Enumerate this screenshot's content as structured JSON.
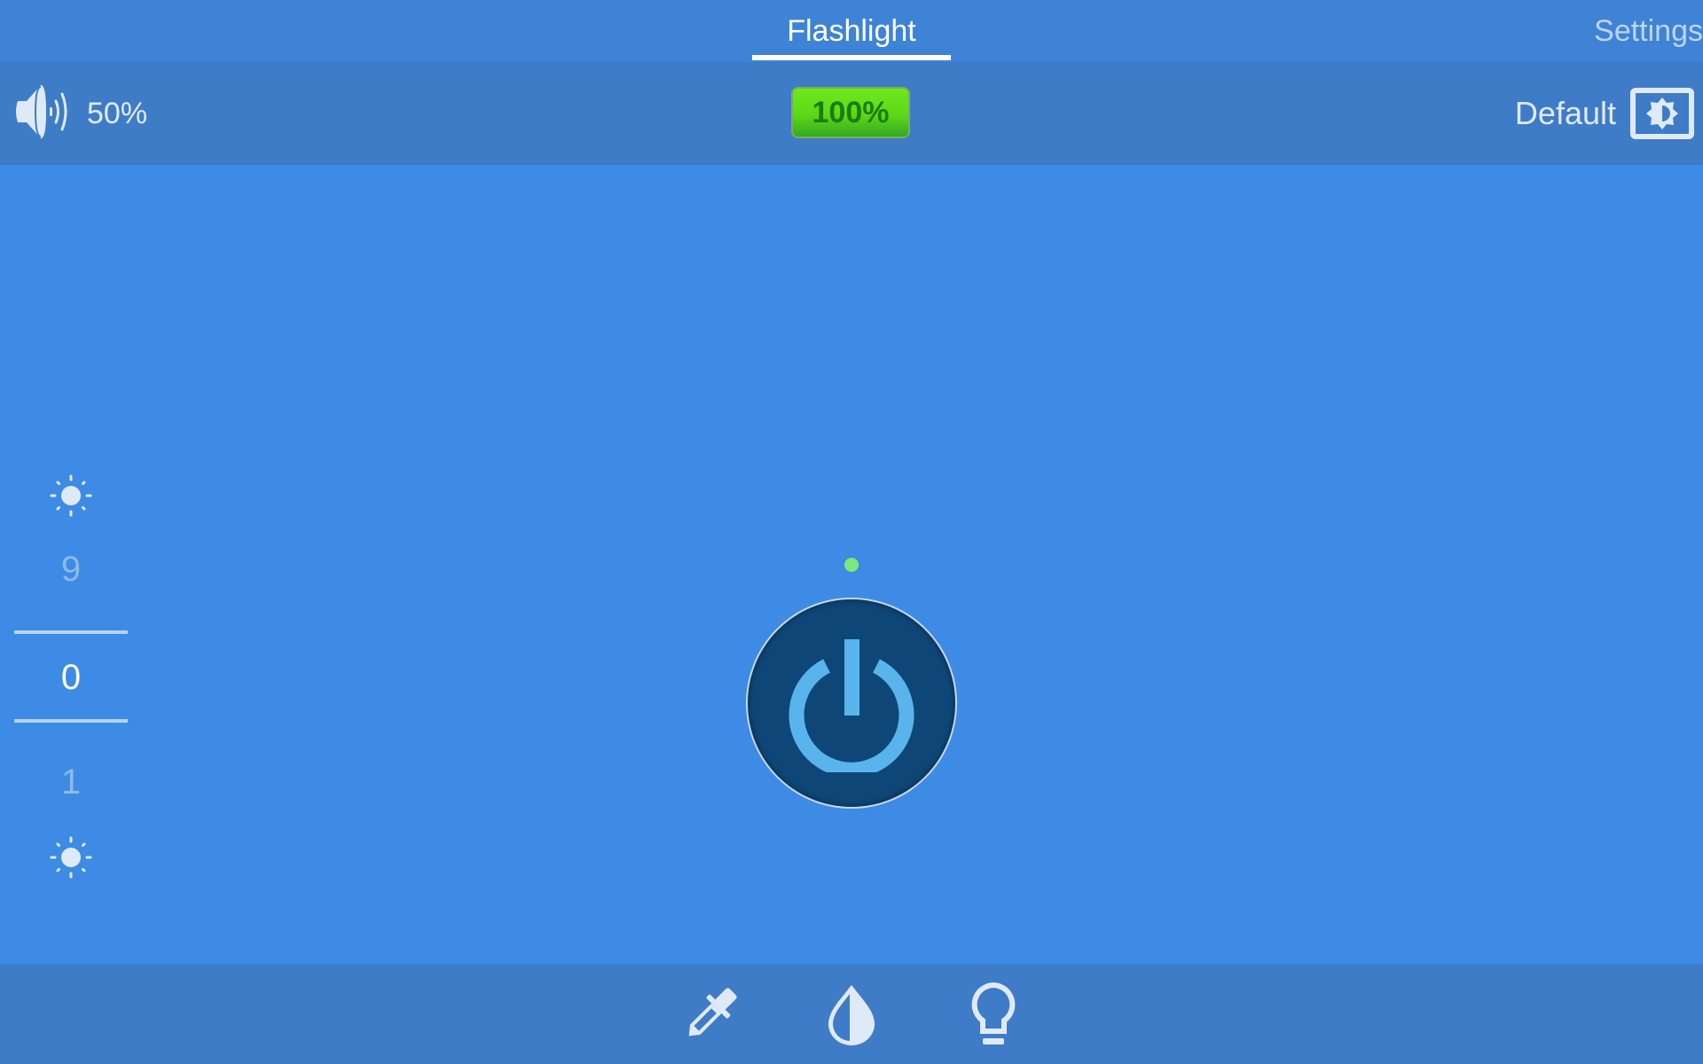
{
  "header": {
    "tabs": [
      {
        "label": "Flashlight",
        "active": true
      },
      {
        "label": "Settings",
        "active": false
      }
    ]
  },
  "toolbar": {
    "volume": {
      "icon": "speaker-icon",
      "value": "50%"
    },
    "battery": {
      "value": "100%",
      "color": "#5ed816"
    },
    "mode": {
      "label": "Default",
      "icon": "screen-brightness-icon"
    }
  },
  "brightness_picker": {
    "top_icon": "sun-icon",
    "bottom_icon": "sun-icon",
    "previous": "9",
    "selected": "0",
    "next": "1"
  },
  "main": {
    "status_dot_color": "#7ee878",
    "power_button": {
      "icon": "power-icon",
      "state": "off"
    }
  },
  "bottom_bar": {
    "buttons": [
      {
        "icon": "eyedropper-icon"
      },
      {
        "icon": "contrast-drop-icon"
      },
      {
        "icon": "lightbulb-icon"
      }
    ]
  }
}
